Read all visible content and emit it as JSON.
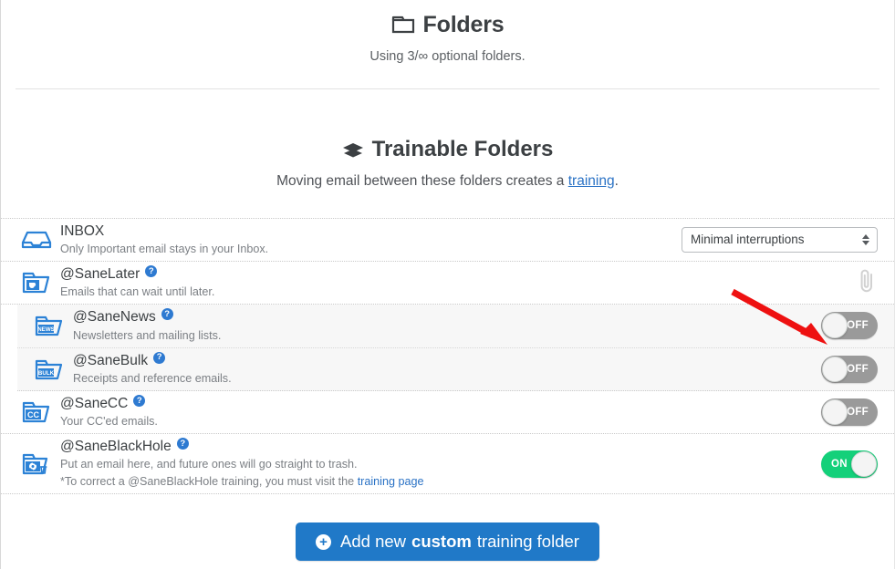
{
  "folders_section": {
    "icon": "open-folder-icon",
    "title": "Folders",
    "subtitle_prefix": "Using 3/",
    "subtitle_infinity": "∞",
    "subtitle_suffix": " optional folders."
  },
  "trainable_section": {
    "icon": "graduation-cap-icon",
    "title": "Trainable Folders",
    "subtitle_prefix": "Moving email between these folders creates a ",
    "subtitle_link": "training",
    "subtitle_suffix": "."
  },
  "rows": [
    {
      "name": "INBOX",
      "desc": "Only Important email stays in your Inbox.",
      "icon": "inbox-tray-icon",
      "has_help": false,
      "nested": false,
      "control": "select"
    },
    {
      "name": "@SaneLater",
      "desc": "Emails that can wait until later.",
      "icon": "folder-coffee-icon",
      "has_help": true,
      "nested": false,
      "control": "paperclip"
    },
    {
      "name": "@SaneNews",
      "desc": "Newsletters and mailing lists.",
      "icon": "folder-news-icon",
      "has_help": true,
      "nested": true,
      "control": "toggle",
      "toggle_state": "OFF"
    },
    {
      "name": "@SaneBulk",
      "desc": "Receipts and reference emails.",
      "icon": "folder-bulk-icon",
      "has_help": true,
      "nested": true,
      "control": "toggle",
      "toggle_state": "OFF"
    },
    {
      "name": "@SaneCC",
      "desc": "Your CC'ed emails.",
      "icon": "folder-cc-icon",
      "has_help": true,
      "nested": false,
      "control": "toggle",
      "toggle_state": "OFF"
    },
    {
      "name": "@SaneBlackHole",
      "desc": "Put an email here, and future ones will go straight to trash.",
      "desc_line2_prefix": "*To correct a @SaneBlackHole training, you must visit the ",
      "desc_line2_link": "training page",
      "icon": "folder-blackhole-icon",
      "has_help": true,
      "nested": false,
      "control": "toggle",
      "toggle_state": "ON"
    }
  ],
  "help_glyph": "?",
  "inbox_select": {
    "value": "Minimal interruptions"
  },
  "footer": {
    "plus_glyph": "+",
    "add_prefix": "Add new",
    "add_strong": "custom",
    "add_suffix": "training folder"
  },
  "icon_labels": {
    "news": "NEWS",
    "bulk": "BULK",
    "cc": "CC"
  },
  "colors": {
    "folder_blue": "#2c82d6",
    "link_blue": "#2a72c5",
    "button_blue": "#2079c8",
    "toggle_on_green": "#14d07a",
    "toggle_off_grey": "#9a9a9a",
    "annotation_red": "#ee1111"
  }
}
